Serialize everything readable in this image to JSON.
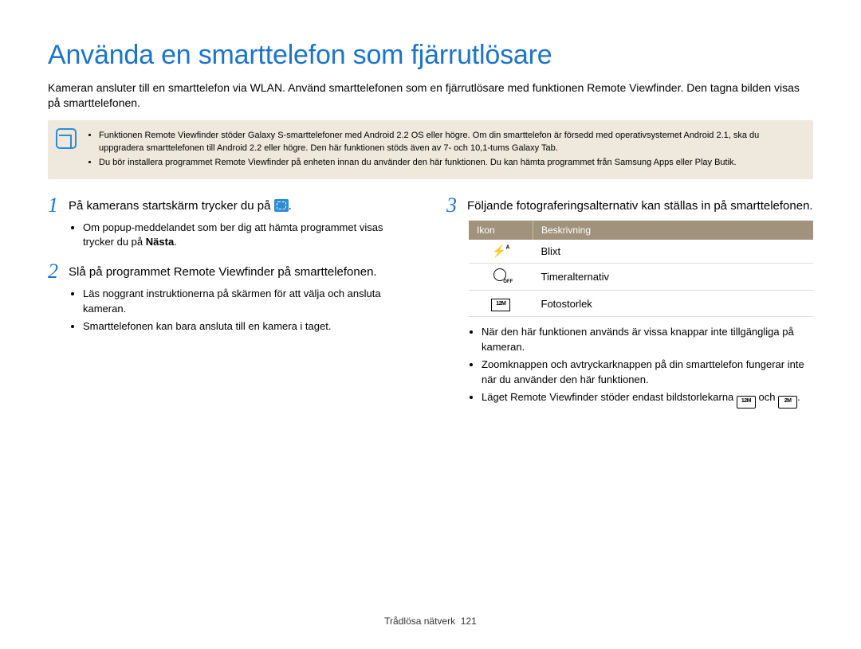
{
  "title": "Använda en smarttelefon som fjärrutlösare",
  "intro": "Kameran ansluter till en smarttelefon via WLAN. Använd smarttelefonen som en fjärrutlösare med funktionen Remote Viewfinder. Den tagna bilden visas på smarttelefonen.",
  "notebox": {
    "items": [
      "Funktionen Remote Viewfinder stöder Galaxy S-smarttelefoner med Android 2.2 OS eller högre. Om din smarttelefon är försedd med operativsystemet Android 2.1, ska du uppgradera smarttelefonen till Android 2.2 eller högre. Den här funktionen stöds även av 7- och 10,1-tums Galaxy Tab.",
      "Du bör installera programmet Remote Viewfinder på enheten innan du använder den här funktionen. Du kan hämta programmet från Samsung Apps eller Play Butik."
    ]
  },
  "steps": {
    "s1": {
      "num": "1",
      "text_pre": "På kamerans startskärm trycker du på ",
      "text_post": ".",
      "sub_pre": "Om popup-meddelandet som ber dig att hämta programmet visas trycker du på ",
      "sub_strong": "Nästa",
      "sub_post": "."
    },
    "s2": {
      "num": "2",
      "text": "Slå på programmet Remote Viewfinder på smarttelefonen.",
      "subs": [
        "Läs noggrant instruktionerna på skärmen för att välja och ansluta kameran.",
        "Smarttelefonen kan bara ansluta till en kamera i taget."
      ]
    },
    "s3": {
      "num": "3",
      "text": "Följande fotograferingsalternativ kan ställas in på smarttelefonen.",
      "table": {
        "head1": "Ikon",
        "head2": "Beskrivning",
        "rows": [
          {
            "icon": "flash",
            "desc": "Blixt"
          },
          {
            "icon": "timer",
            "desc": "Timeralternativ"
          },
          {
            "icon": "photosize",
            "desc": "Fotostorlek"
          }
        ]
      },
      "subs": [
        "När den här funktionen används är vissa knappar inte tillgängliga på kameran.",
        "Zoomknappen och avtryckarknappen på din smarttelefon fungerar inte när du använder den här funktionen."
      ],
      "last_pre": "Läget Remote Viewfinder stöder endast bildstorlekarna ",
      "last_mid": " och ",
      "last_post": "."
    }
  },
  "footer": {
    "section": "Trådlösa nätverk",
    "page": "121"
  }
}
